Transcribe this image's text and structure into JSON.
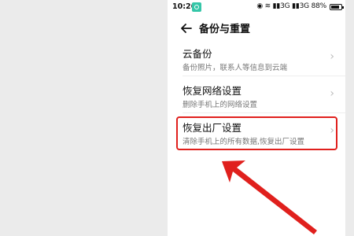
{
  "status_bar": {
    "time": "10:26",
    "icons_text": "◉ ≋ ▮▮3G ▮▮3G",
    "battery": "88%",
    "app_icon": "teal-app-icon"
  },
  "header": {
    "back_icon": "arrow-left-icon",
    "title": "备份与重置"
  },
  "items": [
    {
      "title": "云备份",
      "subtitle": "备份照片，联系人等信息到云端",
      "chevron": "›"
    },
    {
      "title": "恢复网络设置",
      "subtitle": "删除手机上的网络设置",
      "chevron": "›"
    },
    {
      "title": "恢复出厂设置",
      "subtitle": "清除手机上的所有数据,恢复出厂设置",
      "chevron": "›",
      "highlighted": true
    }
  ],
  "colors": {
    "highlight": "#e0201d",
    "background": "#ebebeb",
    "panel": "#ffffff"
  }
}
